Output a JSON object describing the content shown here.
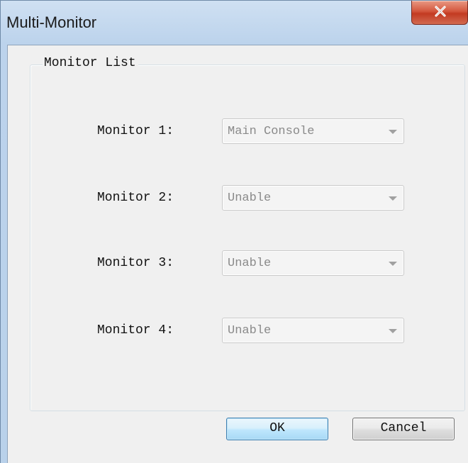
{
  "window": {
    "title": "Multi-Monitor"
  },
  "group": {
    "legend": "Monitor List"
  },
  "monitors": [
    {
      "label": "Monitor 1:",
      "value": "Main Console"
    },
    {
      "label": "Monitor 2:",
      "value": "Unable"
    },
    {
      "label": "Monitor 3:",
      "value": "Unable"
    },
    {
      "label": "Monitor 4:",
      "value": "Unable"
    }
  ],
  "buttons": {
    "ok_label": "OK",
    "cancel_label": "Cancel"
  },
  "icons": {
    "close": "close-icon",
    "dropdown": "chevron-down-icon"
  },
  "colors": {
    "close_button": "#c94a32",
    "ok_border": "#3c7fb1",
    "disabled_text": "#8a8a8a"
  }
}
